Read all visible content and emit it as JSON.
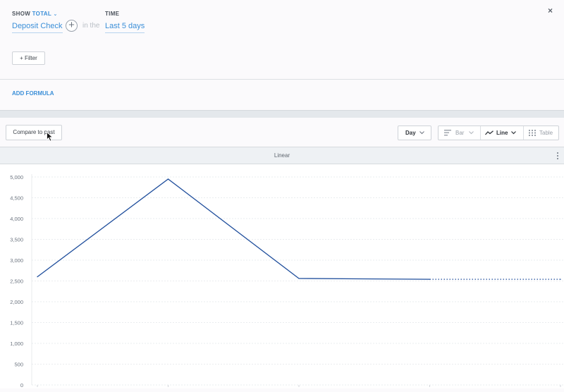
{
  "query": {
    "show_label": "SHOW",
    "show_value": "TOTAL",
    "event": "Deposit Check",
    "in_the": "in the",
    "time_label": "TIME",
    "time_value": "Last 5 days",
    "filter_label": "+ Filter",
    "add_formula": "ADD FORMULA",
    "close": "×"
  },
  "toolbar": {
    "compare_label": "Compare to past",
    "granularity": "Day",
    "chart_types": [
      {
        "label": "Bar",
        "icon": "bar-chart-icon",
        "active": false
      },
      {
        "label": "Line",
        "icon": "line-chart-icon",
        "active": true
      },
      {
        "label": "Table",
        "icon": "table-icon",
        "active": false
      }
    ]
  },
  "chart_header": {
    "scale": "Linear"
  },
  "colors": {
    "accent": "#3b8fd8",
    "line": "#1f4e9c"
  },
  "chart_data": {
    "type": "line",
    "title": "",
    "xlabel": "",
    "ylabel": "",
    "y_ticks": [
      "5,000",
      "4,500",
      "4,000",
      "3,500",
      "3,000",
      "2,500",
      "2,000",
      "1,500",
      "1,000",
      "500",
      "0"
    ],
    "ylim": [
      0,
      5000
    ],
    "x": [
      0,
      1,
      2,
      3,
      4
    ],
    "series": [
      {
        "values": [
          2600,
          4950,
          2560,
          2540,
          2540
        ],
        "partial_from_index": 3
      }
    ],
    "grid": true
  }
}
